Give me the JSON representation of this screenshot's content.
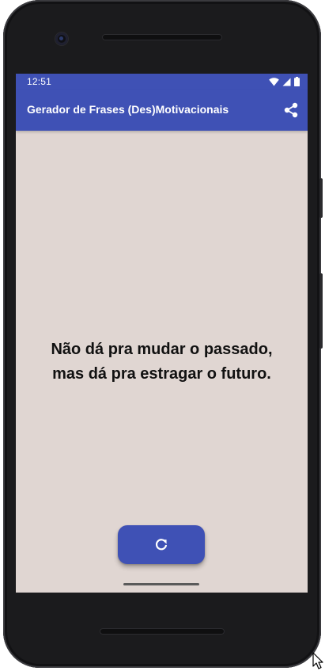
{
  "status_bar": {
    "time": "12:51"
  },
  "app_bar": {
    "title": "Gerador de Frases (Des)Motivacionais",
    "share_icon": "share-icon"
  },
  "quote": {
    "line1": "Não dá pra mudar o passado,",
    "line2": "mas dá pra estragar o futuro."
  },
  "refresh_button": {
    "icon": "refresh-icon"
  },
  "colors": {
    "primary": "#3f51b5",
    "background": "#e0d6d2",
    "text": "#111111"
  }
}
